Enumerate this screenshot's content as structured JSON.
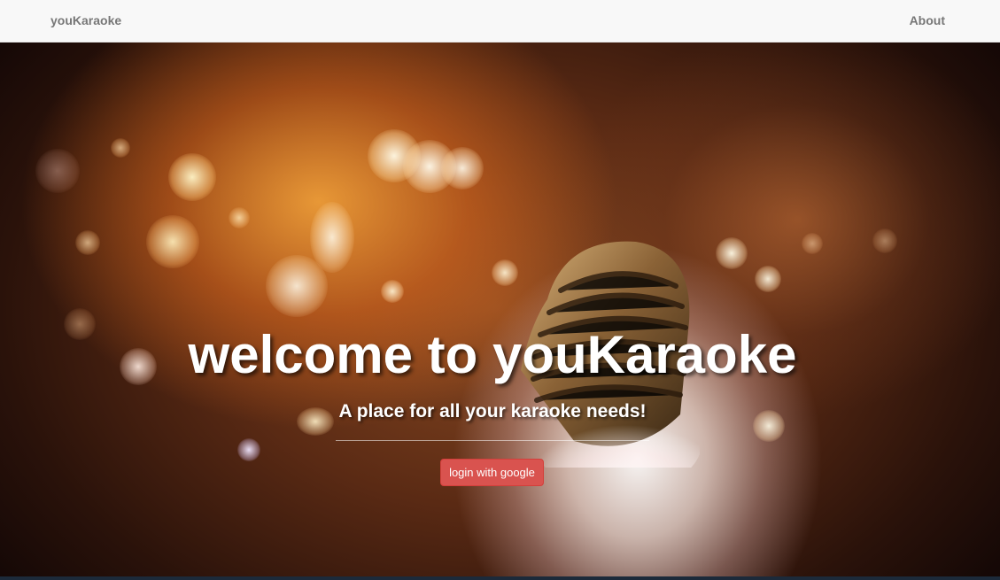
{
  "navbar": {
    "brand": "youKaraoke",
    "about_label": "About"
  },
  "hero": {
    "title": "welcome to youKaraoke",
    "subtitle": "A place for all your karaoke needs!",
    "login_label": "login with google"
  },
  "colors": {
    "navbar_bg": "#f8f8f8",
    "nav_text": "#777777",
    "button_bg": "#d9534f",
    "button_text": "#ffffff",
    "hero_text": "#ffffff"
  },
  "icons": {
    "hero_image": "microphone-icon"
  }
}
